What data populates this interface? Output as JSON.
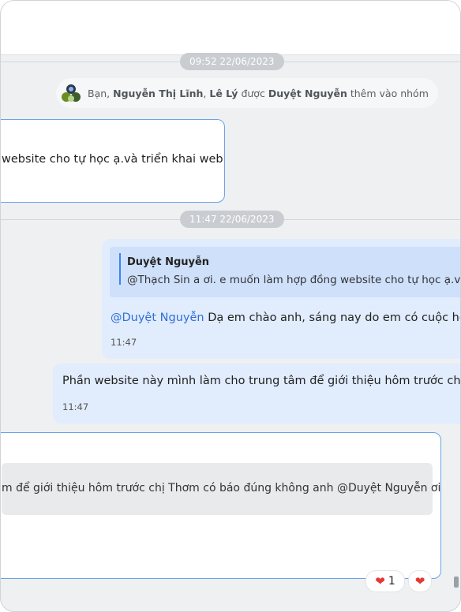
{
  "timestamps": [
    "09:52 22/06/2023",
    "11:47 22/06/2023"
  ],
  "system_message": {
    "prefix": "Bạn,",
    "name1": "Nguyễn Thị Lĩnh",
    "sep": ",",
    "name2": "Lê Lý",
    "mid": "được",
    "name3": "Duyệt Nguyễn",
    "suffix": "thêm vào nhóm"
  },
  "messages": {
    "m1_text": "website cho tự học ạ.và triển khai web ạ",
    "m2_quote_name": "Duyệt Nguyễn",
    "m2_quote_text": "@Thạch Sin a ơi. e muốn làm hợp đồng website cho tự học ạ.và t",
    "m2_mention": "@Duyệt Nguyễn",
    "m2_text": " Dạ em chào anh, sáng nay do em có cuộc họp",
    "m2_time": "11:47",
    "m3_text": "Phần website này mình làm cho trung tâm để giới thiệu hôm trước chị Th",
    "m3_time": "11:47",
    "m4_text": "m để giới thiệu hôm trước chị Thơm có báo đúng không anh @Duyệt Nguyễn ơi?"
  },
  "reactions": {
    "heart_count": "1",
    "heart_icon": "heart-icon"
  },
  "colors": {
    "bg": "#eef0f1",
    "blue_bubble": "#e1ecfd",
    "accent": "#3b82f6",
    "mention": "#2f6fd6"
  }
}
